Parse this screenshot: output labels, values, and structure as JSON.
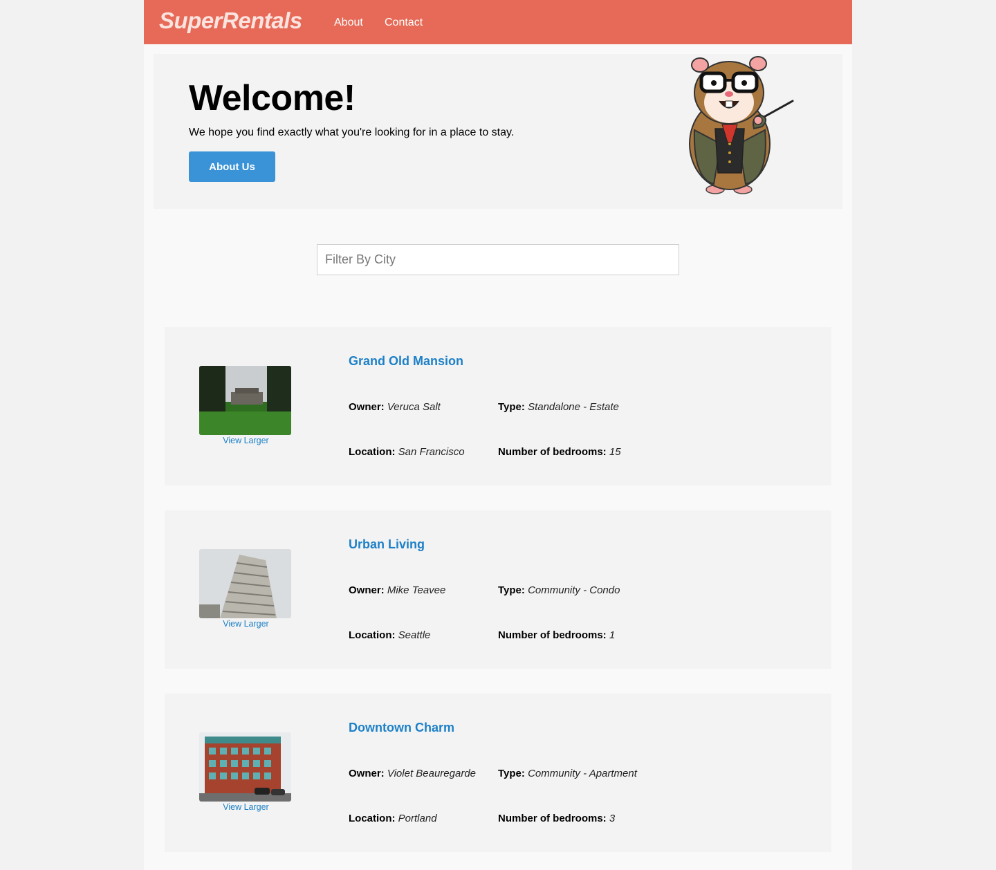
{
  "nav": {
    "brand": "SuperRentals",
    "links": [
      "About",
      "Contact"
    ],
    "accent_color": "#e66a57"
  },
  "jumbo": {
    "title": "Welcome!",
    "text": "We hope you find exactly what you're looking for in a place to stay.",
    "button_label": "About Us",
    "mascot_icon": "tomster-hamster-mascot"
  },
  "filter": {
    "placeholder": "Filter By City",
    "value": ""
  },
  "labels": {
    "owner": "Owner:",
    "type": "Type:",
    "location": "Location:",
    "bedrooms": "Number of bedrooms:",
    "view_larger": "View Larger"
  },
  "rentals": [
    {
      "title": "Grand Old Mansion",
      "owner": "Veruca Salt",
      "type": "Standalone - Estate",
      "location": "San Francisco",
      "bedrooms": "15",
      "image": "mansion-photo"
    },
    {
      "title": "Urban Living",
      "owner": "Mike Teavee",
      "type": "Community - Condo",
      "location": "Seattle",
      "bedrooms": "1",
      "image": "highrise-photo"
    },
    {
      "title": "Downtown Charm",
      "owner": "Violet Beauregarde",
      "type": "Community - Apartment",
      "location": "Portland",
      "bedrooms": "3",
      "image": "apartment-photo"
    }
  ]
}
